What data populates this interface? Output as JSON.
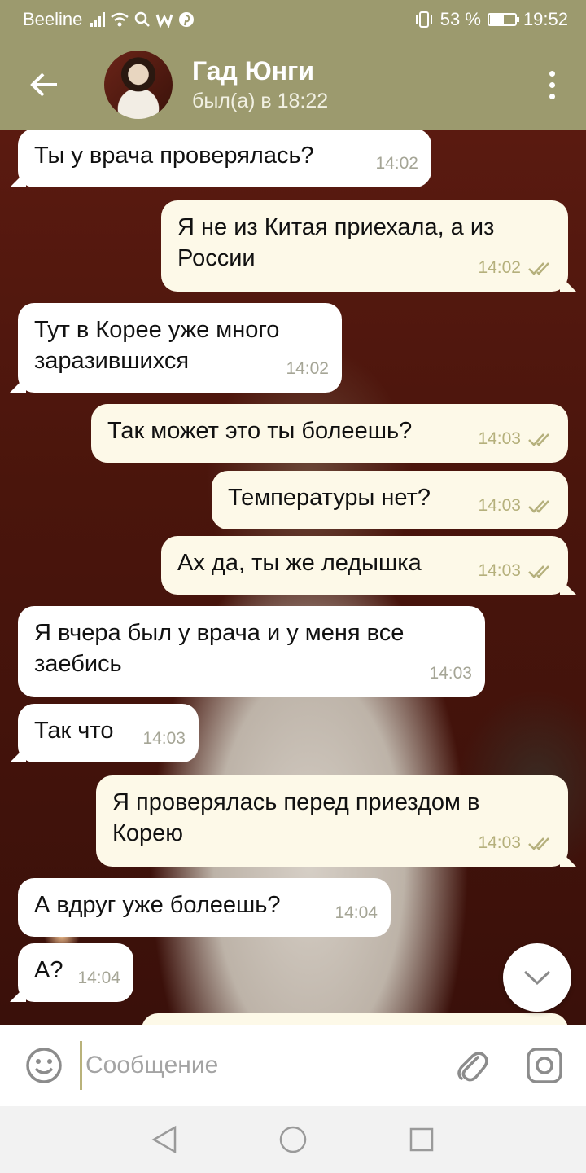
{
  "status": {
    "carrier": "Beeline",
    "battery": "53 %",
    "battery_level": 0.53,
    "time": "19:52"
  },
  "header": {
    "contact_name": "Гад Юнги",
    "last_seen": "был(а) в 18:22"
  },
  "messages": [
    {
      "dir": "in",
      "text": "Ты у врача проверялась?",
      "time": "14:02"
    },
    {
      "dir": "out",
      "text": "Я не из Китая приехала, а из России",
      "time": "14:02"
    },
    {
      "dir": "in",
      "text": "Тут в Корее уже много заразившихся",
      "time": "14:02"
    },
    {
      "dir": "out",
      "text": "Так может это ты болеешь?",
      "time": "14:03"
    },
    {
      "dir": "out",
      "text": "Температуры нет?",
      "time": "14:03"
    },
    {
      "dir": "out",
      "text": "Ах да, ты же ледышка",
      "time": "14:03"
    },
    {
      "dir": "in",
      "text": "Я вчера был у врача и у меня все заебись",
      "time": "14:03"
    },
    {
      "dir": "in",
      "text": "Так что",
      "time": "14:03"
    },
    {
      "dir": "out",
      "text": "Я проверялась перед приездом в Корею",
      "time": "14:03"
    },
    {
      "dir": "in",
      "text": "А вдруг уже болеешь?",
      "time": "14:04"
    },
    {
      "dir": "in",
      "text": "А?",
      "time": "14:04"
    }
  ],
  "composer": {
    "placeholder": "Сообщение"
  },
  "colors": {
    "header": "#9c9a6e",
    "incoming_bubble": "#ffffff",
    "outgoing_bubble": "#fdf9e8",
    "read_ticks": "#b5b07c"
  }
}
